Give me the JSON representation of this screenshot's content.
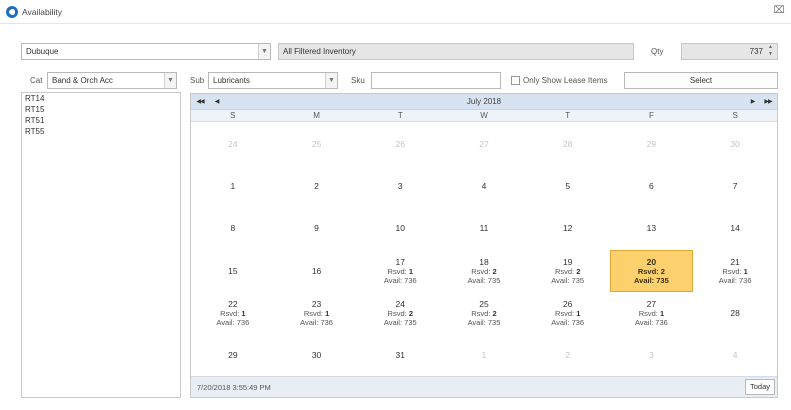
{
  "window": {
    "title": "Availability",
    "close_glyph": "⌧"
  },
  "filters": {
    "location": "Dubuque",
    "inventory": "All Filtered Inventory",
    "qty_label": "Qty",
    "qty_value": "737",
    "cat_label": "Cat",
    "cat_value": "Band & Orch Acc",
    "sub_label": "Sub",
    "sub_value": "Lubricants",
    "sku_label": "Sku",
    "sku_value": "",
    "lease_label": "Only Show Lease Items",
    "select_label": "Select"
  },
  "sku_list": [
    "RT14",
    "RT15",
    "RT51",
    "RT55"
  ],
  "calendar": {
    "month_title": "July 2018",
    "nav": {
      "prev_year": "◀◀",
      "prev": "◀",
      "next": "▶",
      "next_year": "▶▶"
    },
    "weekdays": [
      "S",
      "M",
      "T",
      "W",
      "T",
      "F",
      "S"
    ],
    "weeks": [
      [
        {
          "d": "24",
          "other": true
        },
        {
          "d": "25",
          "other": true
        },
        {
          "d": "26",
          "other": true
        },
        {
          "d": "27",
          "other": true
        },
        {
          "d": "28",
          "other": true
        },
        {
          "d": "29",
          "other": true
        },
        {
          "d": "30",
          "other": true
        }
      ],
      [
        {
          "d": "1"
        },
        {
          "d": "2"
        },
        {
          "d": "3"
        },
        {
          "d": "4"
        },
        {
          "d": "5"
        },
        {
          "d": "6"
        },
        {
          "d": "7"
        }
      ],
      [
        {
          "d": "8"
        },
        {
          "d": "9"
        },
        {
          "d": "10"
        },
        {
          "d": "11"
        },
        {
          "d": "12"
        },
        {
          "d": "13"
        },
        {
          "d": "14"
        }
      ],
      [
        {
          "d": "15"
        },
        {
          "d": "16"
        },
        {
          "d": "17",
          "rsvd": "1",
          "avail": "736"
        },
        {
          "d": "18",
          "rsvd": "2",
          "avail": "735"
        },
        {
          "d": "19",
          "rsvd": "2",
          "avail": "735"
        },
        {
          "d": "20",
          "rsvd": "2",
          "avail": "735",
          "selected": true
        },
        {
          "d": "21",
          "rsvd": "1",
          "avail": "736"
        }
      ],
      [
        {
          "d": "22",
          "rsvd": "1",
          "avail": "736"
        },
        {
          "d": "23",
          "rsvd": "1",
          "avail": "736"
        },
        {
          "d": "24",
          "rsvd": "2",
          "avail": "735"
        },
        {
          "d": "25",
          "rsvd": "2",
          "avail": "735"
        },
        {
          "d": "26",
          "rsvd": "1",
          "avail": "736"
        },
        {
          "d": "27",
          "rsvd": "1",
          "avail": "736"
        },
        {
          "d": "28"
        }
      ],
      [
        {
          "d": "29"
        },
        {
          "d": "30"
        },
        {
          "d": "31"
        },
        {
          "d": "1",
          "other": true
        },
        {
          "d": "2",
          "other": true
        },
        {
          "d": "3",
          "other": true
        },
        {
          "d": "4",
          "other": true
        }
      ]
    ],
    "rsvd_label": "Rsvd:",
    "avail_label": "Avail:",
    "footer_time": "7/20/2018 3:55:49 PM",
    "today_label": "Today"
  },
  "colors": {
    "selected_day": "#fbd06d",
    "nav_bar": "#d7e3f1",
    "accent": "#1e6fc1"
  }
}
